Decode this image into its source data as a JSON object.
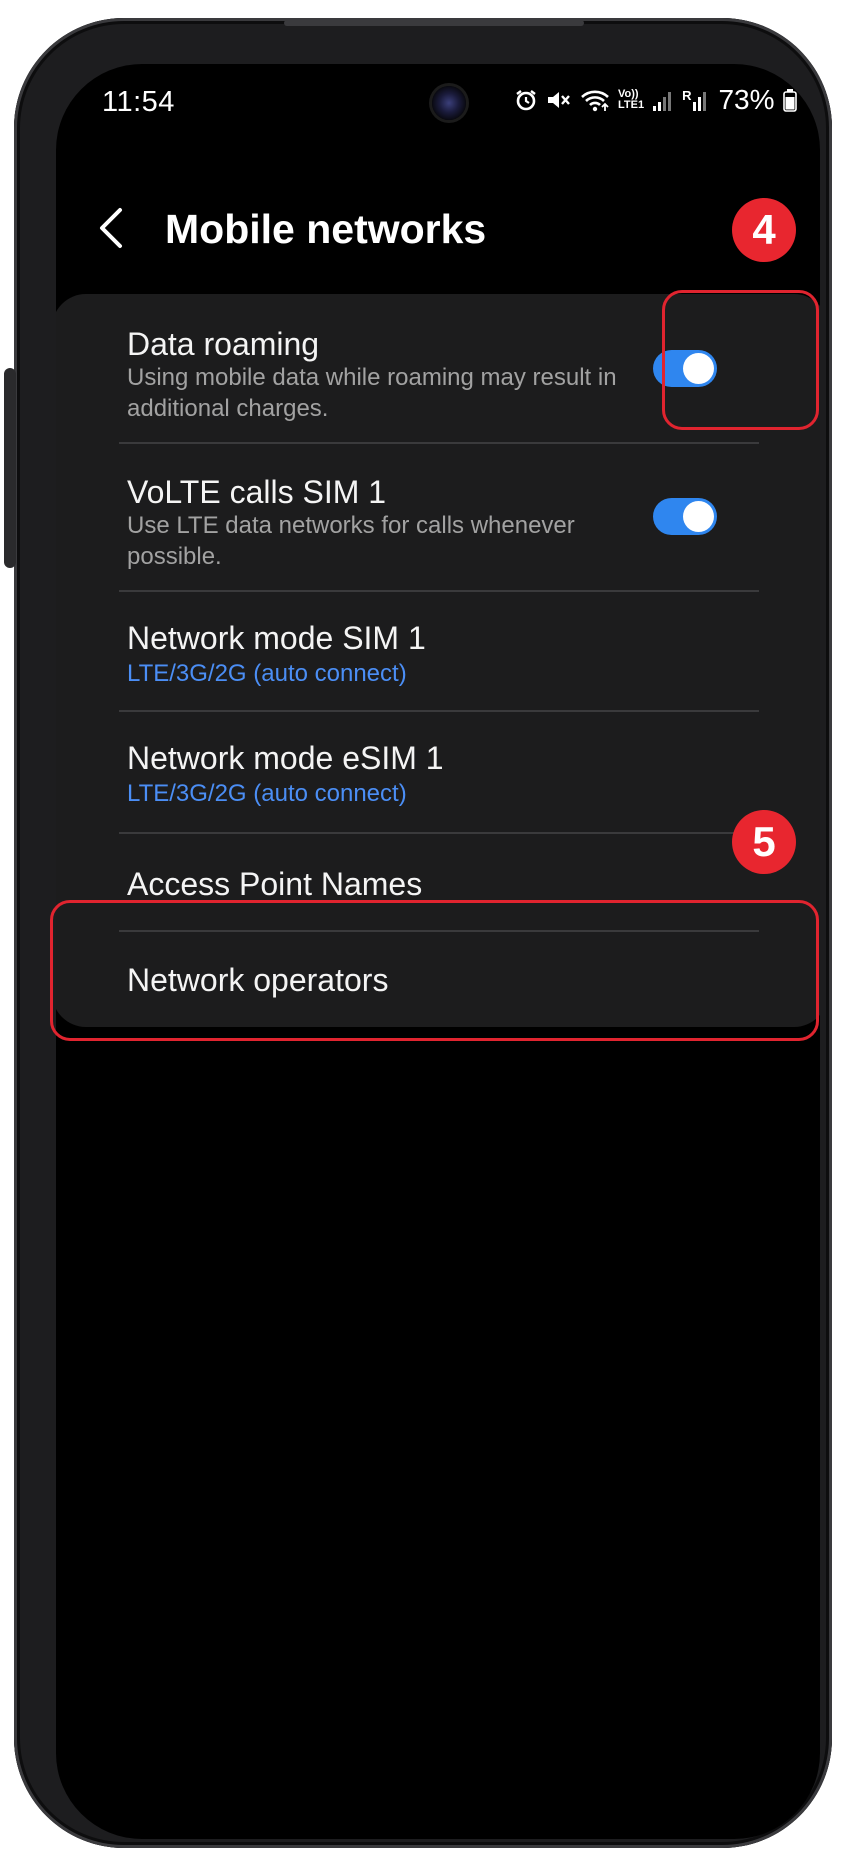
{
  "status_bar": {
    "time": "11:54",
    "volte_label_top": "Vo))",
    "volte_label_bottom": "LTE1",
    "roaming_indicator": "R",
    "battery_percent": "73%",
    "icons": [
      "alarm-icon",
      "mute-icon",
      "wifi-icon",
      "volte-icon",
      "signal-icon",
      "signal-roaming-icon",
      "battery-icon"
    ]
  },
  "header": {
    "title": "Mobile networks",
    "back_icon": "chevron-left-icon"
  },
  "settings": [
    {
      "label": "Data roaming",
      "description": "Using mobile data while roaming may result in additional charges.",
      "toggle_on": true
    },
    {
      "label": "VoLTE calls SIM 1",
      "description": "Use LTE data networks for calls whenever possible.",
      "toggle_on": true
    },
    {
      "label": "Network mode SIM 1",
      "value": "LTE/3G/2G (auto connect)"
    },
    {
      "label": "Network mode eSIM 1",
      "value": "LTE/3G/2G (auto connect)"
    },
    {
      "label": "Access Point Names"
    },
    {
      "label": "Network operators"
    }
  ],
  "annotations": {
    "step_toggle": "4",
    "step_apn": "5",
    "color": "#e0242f"
  },
  "colors": {
    "accent": "#2f86ef",
    "link": "#4b8ef5",
    "card": "#1c1c1d"
  }
}
